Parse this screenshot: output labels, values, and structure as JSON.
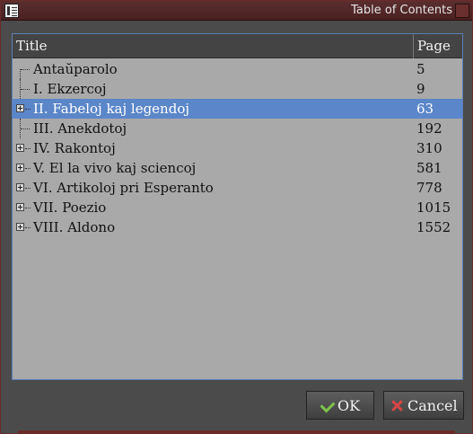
{
  "window": {
    "title": "Table of Contents"
  },
  "tree": {
    "header": {
      "title": "Title",
      "page": "Page"
    },
    "rows": [
      {
        "label": "Antaŭparolo",
        "page": "5",
        "expandable": false,
        "selected": false
      },
      {
        "label": "I. Ekzercoj",
        "page": "9",
        "expandable": false,
        "selected": false
      },
      {
        "label": "II. Fabeloj kaj legendoj",
        "page": "63",
        "expandable": true,
        "selected": true
      },
      {
        "label": "III. Anekdotoj",
        "page": "192",
        "expandable": false,
        "selected": false
      },
      {
        "label": "IV. Rakontoj",
        "page": "310",
        "expandable": true,
        "selected": false
      },
      {
        "label": "V. El la vivo kaj sciencoj",
        "page": "581",
        "expandable": true,
        "selected": false
      },
      {
        "label": "VI. Artikoloj pri Esperanto",
        "page": "778",
        "expandable": true,
        "selected": false
      },
      {
        "label": "VII. Poezio",
        "page": "1015",
        "expandable": true,
        "selected": false
      },
      {
        "label": "VIII. Aldono",
        "page": "1552",
        "expandable": true,
        "selected": false
      }
    ]
  },
  "buttons": {
    "ok": "OK",
    "cancel": "Cancel"
  },
  "colors": {
    "selection": "#5b86c9",
    "tree_bg": "#a9a9a9",
    "titlebar": "#4a2020"
  }
}
